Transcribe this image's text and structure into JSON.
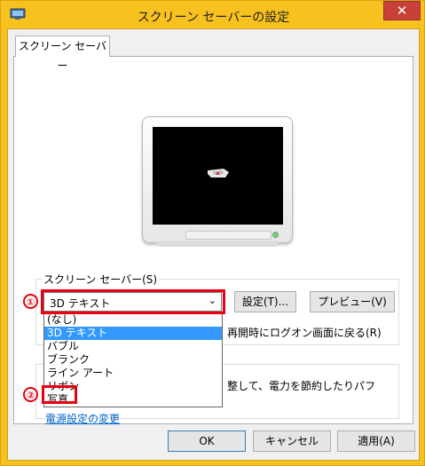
{
  "window": {
    "title": "スクリーン セーバーの設定",
    "close_label": "✕"
  },
  "tabs": [
    {
      "label": "スクリーン セーバー"
    }
  ],
  "screensaver": {
    "group_label": "スクリーン セーバー(S)",
    "selected": "3D テキスト",
    "settings_label": "設定(T)...",
    "preview_label": "プレビュー(V)",
    "resume_text": "再開時にログオン画面に戻る(R)"
  },
  "dropdown_options": [
    "(なし)",
    "3D テキスト",
    "バブル",
    "ブランク",
    "ライン アート",
    "リボン",
    "写真"
  ],
  "power": {
    "text": "整して、電力を節約したりパフ",
    "link": "電源設定の変更"
  },
  "footer": {
    "ok_label": "OK",
    "cancel_label": "キャンセル",
    "apply_label": "適用(A)"
  },
  "annotations": {
    "one": "①",
    "two": "②"
  },
  "colors": {
    "title_bar": "#f7c11f",
    "close_button": "#c7403a",
    "highlight": "#e60012",
    "selection": "#3399ff",
    "link": "#0066cc"
  }
}
